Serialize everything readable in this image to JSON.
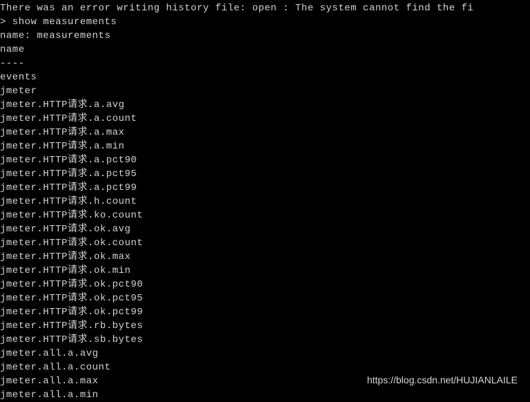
{
  "terminal": {
    "error_line": "There was an error writing history file: open : The system cannot find the fi",
    "command_line": "> show measurements",
    "name_line": "name: measurements",
    "header": "name",
    "divider": "----",
    "rows": [
      "events",
      "jmeter",
      "jmeter.HTTP请求.a.avg",
      "jmeter.HTTP请求.a.count",
      "jmeter.HTTP请求.a.max",
      "jmeter.HTTP请求.a.min",
      "jmeter.HTTP请求.a.pct90",
      "jmeter.HTTP请求.a.pct95",
      "jmeter.HTTP请求.a.pct99",
      "jmeter.HTTP请求.h.count",
      "jmeter.HTTP请求.ko.count",
      "jmeter.HTTP请求.ok.avg",
      "jmeter.HTTP请求.ok.count",
      "jmeter.HTTP请求.ok.max",
      "jmeter.HTTP请求.ok.min",
      "jmeter.HTTP请求.ok.pct90",
      "jmeter.HTTP请求.ok.pct95",
      "jmeter.HTTP请求.ok.pct99",
      "jmeter.HTTP请求.rb.bytes",
      "jmeter.HTTP请求.sb.bytes",
      "jmeter.all.a.avg",
      "jmeter.all.a.count",
      "jmeter.all.a.max",
      "jmeter.all.a.min"
    ]
  },
  "watermark": "https://blog.csdn.net/HUJIANLAILE"
}
